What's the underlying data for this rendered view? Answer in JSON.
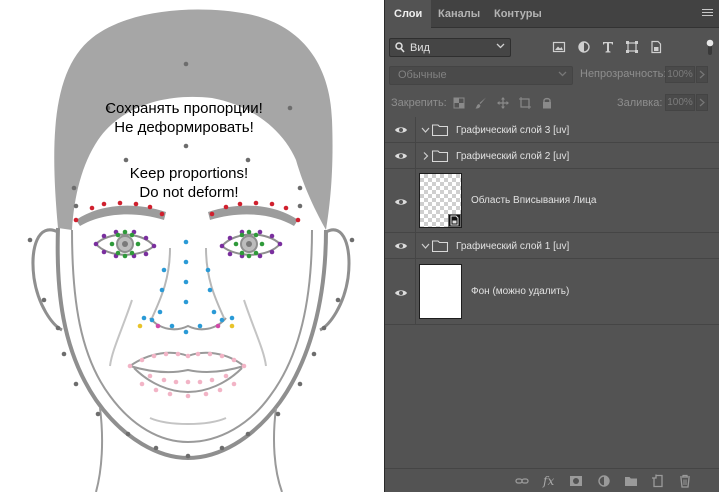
{
  "canvas": {
    "text_ru_line1": "Сохранять пропорции!",
    "text_ru_line2": "Не деформировать!",
    "text_en_line1": "Keep proportions!",
    "text_en_line2": "Do not deform!",
    "colors": {
      "hair": "#a6a6a6",
      "outline": "#8f8f8f",
      "brow_points": "#d0202e",
      "eye_points": "#7a2f9e",
      "iris_points": "#2f9a3a",
      "nose_points": "#2a9ad6",
      "nostril_wing_points": "#e8c32a",
      "nostril_side_points": "#d14aa8",
      "lip_points": "#f2b4c6",
      "contour_points": "#6d6d6d"
    }
  },
  "panel": {
    "tabs": [
      {
        "label": "Слои",
        "active": true
      },
      {
        "label": "Каналы",
        "active": false
      },
      {
        "label": "Контуры",
        "active": false
      }
    ],
    "filter": {
      "icon": "search-icon",
      "label": "Вид",
      "icons": [
        "image-filter-icon",
        "adjustment-filter-icon",
        "type-filter-icon",
        "shape-filter-icon",
        "smart-object-filter-icon"
      ]
    },
    "blend_mode": "Обычные",
    "opacity_label": "Непрозрачность:",
    "opacity_value": "100%",
    "lock_label": "Закрепить:",
    "fill_label": "Заливка:",
    "fill_value": "100%",
    "layers": [
      {
        "name": "Графический слой 3 [uv]",
        "type": "group",
        "expanded": true,
        "visible": true
      },
      {
        "name": "Графический слой 2 [uv]",
        "type": "group",
        "expanded": false,
        "visible": true
      },
      {
        "name": "Область Вписывания Лица",
        "type": "smart-object",
        "visible": true
      },
      {
        "name": "Графический слой 1 [uv]",
        "type": "group",
        "expanded": true,
        "visible": true
      },
      {
        "name": "Фон (можно удалить)",
        "type": "pixel",
        "visible": true
      }
    ],
    "bottom_icons": [
      "link-layers-icon",
      "fx-icon",
      "add-mask-icon",
      "adjustment-layer-icon",
      "new-group-icon",
      "new-layer-icon",
      "delete-layer-icon"
    ],
    "bottom_fx": "fx"
  }
}
